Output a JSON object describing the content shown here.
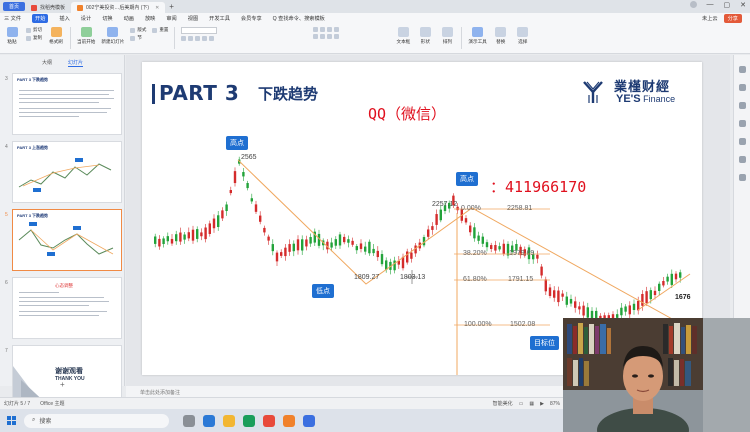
{
  "titlebar": {
    "home": "首页",
    "tabs": [
      {
        "label": "找稻壳模板",
        "color": "#e84a3b",
        "active": false
      },
      {
        "label": "002宁美投资…后美期內 (下)",
        "color": "#f0812b",
        "active": true
      }
    ],
    "new_tab": "+"
  },
  "menu": {
    "file": "三 文件",
    "items": [
      "开始",
      "插入",
      "设计",
      "切换",
      "动画",
      "放映",
      "审阅",
      "视图",
      "开发工具",
      "会员专享",
      "Q 查找命令、搜索模板"
    ],
    "active": "开始",
    "cloud": "未上云",
    "share": "分享"
  },
  "ribbon": {
    "buttons": [
      "粘贴",
      "格式刷",
      "当前开始",
      "新建幻灯片",
      "版式",
      "节",
      "重置",
      "文本框",
      "形状",
      "排列",
      "演示工具",
      "替换",
      "选择"
    ],
    "small": [
      "剪切",
      "复制",
      "重置"
    ]
  },
  "panel": {
    "tabs": [
      "大纲",
      "幻灯片"
    ],
    "active_tab": "幻灯片",
    "slides": [
      {
        "num": "3",
        "title": "PART 3 下跌趋势"
      },
      {
        "num": "4",
        "title": "PART 3 上涨趋势"
      },
      {
        "num": "5",
        "title": "PART 3 下跌趋势"
      },
      {
        "num": "6",
        "title": "心态调整"
      },
      {
        "num": "7",
        "title": "谢谢观看",
        "subtitle": "THANK YOU"
      }
    ]
  },
  "slide": {
    "part": "PART 3",
    "title": "下跌趋势",
    "logo_cn": "業槿财經",
    "logo_en_a": "YE'S",
    "logo_en_b": "Finance",
    "watermark_a": "QQ（微信）",
    "watermark_b": "：411966170",
    "callouts": [
      "高点",
      "低点",
      "高点",
      "目标位"
    ],
    "prices": [
      "2565",
      "1809.27",
      "1803.13",
      "2257.12",
      "1676"
    ],
    "fib_levels": [
      {
        "pct": "0.00%",
        "price": "2258.81"
      },
      {
        "pct": "38.20%",
        "price": "1979.69"
      },
      {
        "pct": "61.80%",
        "price": "1791.15"
      },
      {
        "pct": "100.00%",
        "price": "1502.08"
      }
    ]
  },
  "notes": "单击此处添加备注",
  "status": {
    "slide": "幻灯片 5 / 7",
    "theme": "Office 主题",
    "smart": "智能美化",
    "zoom": "87%"
  },
  "taskbar": {
    "search": "搜索"
  },
  "colors": {
    "up": "#22a33a",
    "down": "#d42b2b",
    "accent": "#1e3b73",
    "trend": "#f0a860",
    "watermark": "#e0101e"
  }
}
